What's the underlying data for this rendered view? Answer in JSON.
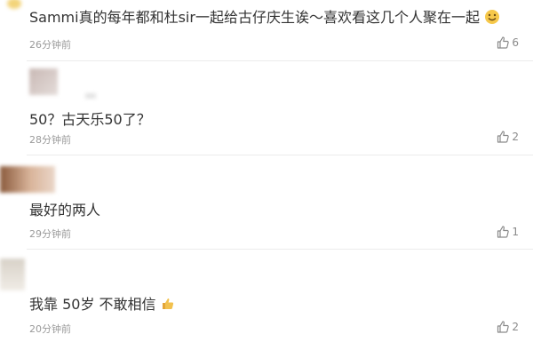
{
  "comments": [
    {
      "text": "Sammi真的每年都和杜sir一起给古仔庆生诶～喜欢看这几个人聚在一起",
      "time": "26分钟前",
      "likes": "6",
      "trailing_emoji": "grin-emoji"
    },
    {
      "text": "50？古天乐50了？",
      "time": "28分钟前",
      "likes": "2"
    },
    {
      "text": "最好的两人",
      "time": "29分钟前",
      "likes": "1"
    },
    {
      "text": "我靠 50岁 不敢相信",
      "time": "20分钟前",
      "likes": "2",
      "trailing_emoji": "thumb-emoji"
    }
  ],
  "colors": {
    "text": "#333333",
    "meta": "#9a9a9a",
    "divider": "#ececec"
  }
}
